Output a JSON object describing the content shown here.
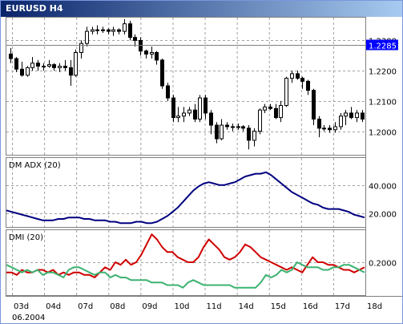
{
  "window": {
    "title": "EURUSD H4"
  },
  "colors": {
    "bull": "#ffffff",
    "bear": "#000000",
    "adx": "#000080",
    "plus_di": "#d00000",
    "minus_di": "#3cb371",
    "price_badge": "#0000ff",
    "grid": "#a0a0a0"
  },
  "icons": [
    "window-title-icon"
  ],
  "chart_data": [
    {
      "type": "candlestick",
      "title": "EURUSD H4",
      "ylim": [
        1.193,
        1.237
      ],
      "y_ticks": [
        "1.2300",
        "1.2200",
        "1.2100",
        "1.2000"
      ],
      "current_price": "1.2285",
      "x_labels": [
        "03d",
        "04d",
        "07d",
        "08d",
        "09d",
        "10d",
        "11d",
        "14d",
        "15d",
        "16d",
        "17d",
        "18d"
      ],
      "date_label": "06.2004",
      "grid": true,
      "candles": [
        [
          1.2255,
          1.2275,
          1.2225,
          1.224
        ],
        [
          1.224,
          1.2245,
          1.2195,
          1.2205
        ],
        [
          1.2205,
          1.223,
          1.218,
          1.2185
        ],
        [
          1.2185,
          1.2215,
          1.218,
          1.221
        ],
        [
          1.221,
          1.2245,
          1.22,
          1.2225
        ],
        [
          1.2225,
          1.2235,
          1.22,
          1.2215
        ],
        [
          1.2215,
          1.2225,
          1.22,
          1.2215
        ],
        [
          1.2215,
          1.2235,
          1.221,
          1.222
        ],
        [
          1.222,
          1.2225,
          1.22,
          1.221
        ],
        [
          1.221,
          1.2225,
          1.2195,
          1.2215
        ],
        [
          1.2215,
          1.2235,
          1.22,
          1.221
        ],
        [
          1.221,
          1.2235,
          1.215,
          1.2185
        ],
        [
          1.2185,
          1.227,
          1.218,
          1.226
        ],
        [
          1.226,
          1.23,
          1.224,
          1.229
        ],
        [
          1.229,
          1.2345,
          1.228,
          1.233
        ],
        [
          1.233,
          1.2345,
          1.232,
          1.2335
        ],
        [
          1.2335,
          1.235,
          1.232,
          1.2335
        ],
        [
          1.2335,
          1.2345,
          1.2325,
          1.2335
        ],
        [
          1.2335,
          1.234,
          1.232,
          1.233
        ],
        [
          1.233,
          1.2345,
          1.2315,
          1.2335
        ],
        [
          1.2335,
          1.234,
          1.232,
          1.233
        ],
        [
          1.233,
          1.237,
          1.232,
          1.2355
        ],
        [
          1.2355,
          1.2365,
          1.23,
          1.231
        ],
        [
          1.231,
          1.232,
          1.228,
          1.23
        ],
        [
          1.23,
          1.231,
          1.225,
          1.2265
        ],
        [
          1.2265,
          1.227,
          1.224,
          1.2255
        ],
        [
          1.2255,
          1.228,
          1.224,
          1.226
        ],
        [
          1.226,
          1.2265,
          1.222,
          1.2235
        ],
        [
          1.2235,
          1.224,
          1.214,
          1.215
        ],
        [
          1.215,
          1.216,
          1.21,
          1.211
        ],
        [
          1.211,
          1.212,
          1.203,
          1.2045
        ],
        [
          1.2045,
          1.208,
          1.203,
          1.205
        ],
        [
          1.205,
          1.208,
          1.203,
          1.206
        ],
        [
          1.206,
          1.208,
          1.205,
          1.207
        ],
        [
          1.207,
          1.209,
          1.203,
          1.204
        ],
        [
          1.204,
          1.212,
          1.203,
          1.211
        ],
        [
          1.211,
          1.212,
          1.204,
          1.206
        ],
        [
          1.206,
          1.207,
          1.199,
          1.202
        ],
        [
          1.202,
          1.203,
          1.196,
          1.1975
        ],
        [
          1.1975,
          1.204,
          1.197,
          1.202
        ],
        [
          1.202,
          1.203,
          1.2005,
          1.2015
        ],
        [
          1.2015,
          1.2025,
          1.2,
          1.2015
        ],
        [
          1.2015,
          1.2025,
          1.2005,
          1.2015
        ],
        [
          1.2015,
          1.202,
          1.2,
          1.201
        ],
        [
          1.201,
          1.202,
          1.194,
          1.197
        ],
        [
          1.197,
          1.201,
          1.195,
          1.2
        ],
        [
          1.2,
          1.2075,
          1.199,
          1.207
        ],
        [
          1.207,
          1.209,
          1.206,
          1.208
        ],
        [
          1.208,
          1.209,
          1.207,
          1.2075
        ],
        [
          1.2075,
          1.209,
          1.204,
          1.2045
        ],
        [
          1.2045,
          1.21,
          1.203,
          1.2085
        ],
        [
          1.2085,
          1.218,
          1.208,
          1.2175
        ],
        [
          1.2175,
          1.22,
          1.216,
          1.219
        ],
        [
          1.219,
          1.22,
          1.217,
          1.2175
        ],
        [
          1.2175,
          1.218,
          1.214,
          1.2165
        ],
        [
          1.2165,
          1.217,
          1.212,
          1.2135
        ],
        [
          1.2135,
          1.214,
          1.202,
          1.204
        ],
        [
          1.204,
          1.205,
          1.198,
          1.201
        ],
        [
          1.201,
          1.202,
          1.2,
          1.201
        ],
        [
          1.201,
          1.202,
          1.1995,
          1.2005
        ],
        [
          1.2005,
          1.203,
          1.1995,
          1.2015
        ],
        [
          1.2015,
          1.206,
          1.2005,
          1.205
        ],
        [
          1.205,
          1.207,
          1.202,
          1.206
        ],
        [
          1.206,
          1.208,
          1.204,
          1.2045
        ],
        [
          1.2045,
          1.207,
          1.203,
          1.206
        ],
        [
          1.206,
          1.207,
          1.203,
          1.204
        ]
      ]
    },
    {
      "type": "line",
      "title": "DM ADX (20)",
      "ylim": [
        12,
        58
      ],
      "y_ticks": [
        "40.000",
        "20.000"
      ],
      "series": [
        {
          "values": [
            22,
            21,
            20,
            19,
            18,
            17,
            16,
            15,
            15,
            15,
            16,
            16,
            17,
            17,
            17,
            16,
            16,
            15,
            15,
            15,
            14,
            14,
            13,
            13,
            13,
            14,
            14,
            13,
            13,
            14,
            16,
            18,
            21,
            24,
            28,
            32,
            36,
            39,
            41,
            42,
            41,
            40,
            40,
            41,
            42,
            44,
            46,
            47,
            48,
            48,
            49,
            47,
            44,
            41,
            38,
            35,
            33,
            31,
            29,
            27,
            26,
            24,
            23,
            23,
            23,
            22,
            21,
            19,
            18,
            17
          ]
        }
      ]
    },
    {
      "type": "line",
      "title": "DMI (20)",
      "ylim": [
        0.08,
        0.32
      ],
      "y_ticks": [
        "0.2000"
      ],
      "series": [
        {
          "values": [
            0.16,
            0.16,
            0.15,
            0.17,
            0.16,
            0.16,
            0.17,
            0.17,
            0.16,
            0.17,
            0.15,
            0.16,
            0.15,
            0.16,
            0.16,
            0.15,
            0.15,
            0.14,
            0.16,
            0.18,
            0.17,
            0.2,
            0.19,
            0.21,
            0.19,
            0.2,
            0.23,
            0.27,
            0.31,
            0.29,
            0.26,
            0.24,
            0.24,
            0.22,
            0.21,
            0.2,
            0.2,
            0.22,
            0.26,
            0.29,
            0.27,
            0.25,
            0.22,
            0.21,
            0.22,
            0.24,
            0.27,
            0.26,
            0.24,
            0.22,
            0.21,
            0.2,
            0.19,
            0.18,
            0.17,
            0.18,
            0.17,
            0.16,
            0.19,
            0.22,
            0.2,
            0.2,
            0.19,
            0.19,
            0.18,
            0.17,
            0.17,
            0.16,
            0.17,
            0.18
          ]
        },
        {
          "values": [
            0.19,
            0.18,
            0.17,
            0.16,
            0.17,
            0.16,
            0.17,
            0.15,
            0.16,
            0.16,
            0.15,
            0.14,
            0.17,
            0.18,
            0.18,
            0.17,
            0.16,
            0.15,
            0.16,
            0.16,
            0.14,
            0.15,
            0.14,
            0.14,
            0.13,
            0.13,
            0.13,
            0.13,
            0.12,
            0.12,
            0.12,
            0.11,
            0.11,
            0.11,
            0.1,
            0.12,
            0.13,
            0.12,
            0.11,
            0.11,
            0.11,
            0.11,
            0.11,
            0.11,
            0.1,
            0.1,
            0.1,
            0.1,
            0.1,
            0.12,
            0.15,
            0.14,
            0.15,
            0.17,
            0.16,
            0.17,
            0.2,
            0.19,
            0.18,
            0.18,
            0.18,
            0.17,
            0.17,
            0.18,
            0.18,
            0.19,
            0.19,
            0.18,
            0.17,
            0.16
          ]
        }
      ]
    }
  ]
}
